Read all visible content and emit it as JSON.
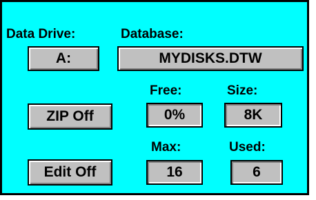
{
  "colors": {
    "panel_background": "#00ffff",
    "button_face": "#c0c0c0",
    "text": "#000000"
  },
  "data_drive": {
    "label": "Data Drive:",
    "value": "A:"
  },
  "database": {
    "label": "Database:",
    "value": "MYDISKS.DTW"
  },
  "zip_button": {
    "label": "ZIP Off"
  },
  "edit_button": {
    "label": "Edit Off"
  },
  "stats": {
    "free": {
      "label": "Free:",
      "value": "0%"
    },
    "size": {
      "label": "Size:",
      "value": "8K"
    },
    "max": {
      "label": "Max:",
      "value": "16"
    },
    "used": {
      "label": "Used:",
      "value": "6"
    }
  }
}
